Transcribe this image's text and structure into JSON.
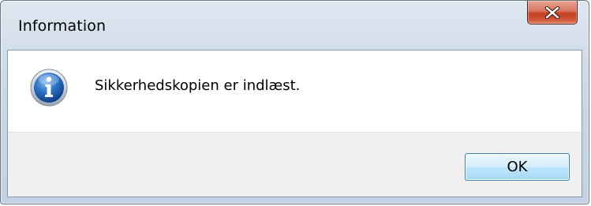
{
  "window": {
    "title": "Information",
    "close_icon": "close-icon"
  },
  "dialog": {
    "icon": "info-icon",
    "message": "Sikkerhedskopien er indlæst.",
    "ok_label": "OK"
  },
  "colors": {
    "ok_border": "#3c7fb1",
    "close_button": "#c2401f",
    "info_icon_blue": "#1f5fb4"
  }
}
